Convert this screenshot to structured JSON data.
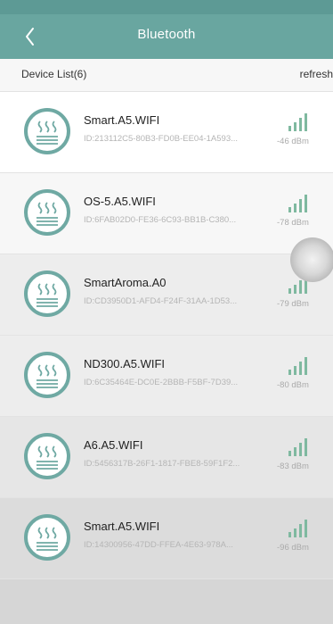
{
  "header": {
    "title": "Bluetooth"
  },
  "list_header": {
    "count_label": "Device List(6)",
    "refresh_label": "refresh"
  },
  "colors": {
    "accent": "#69a6a0",
    "signal": "#7fb9a0"
  },
  "devices": [
    {
      "name": "Smart.A5.WIFI",
      "id": "ID:213112C5-80B3-FD0B-EE04-1A593...",
      "rssi": "-46 dBm",
      "icon": "diffuser-icon",
      "signal_icon": "signal-bars-icon"
    },
    {
      "name": "OS-5.A5.WIFI",
      "id": "ID:6FAB02D0-FE36-6C93-BB1B-C380...",
      "rssi": "-78 dBm",
      "icon": "diffuser-icon",
      "signal_icon": "signal-bars-icon"
    },
    {
      "name": "SmartAroma.A0",
      "id": "ID:CD3950D1-AFD4-F24F-31AA-1D53...",
      "rssi": "-79 dBm",
      "icon": "diffuser-icon",
      "signal_icon": "signal-bars-icon"
    },
    {
      "name": "ND300.A5.WIFI",
      "id": "ID:6C35464E-DC0E-2BBB-F5BF-7D39...",
      "rssi": "-80 dBm",
      "icon": "diffuser-icon",
      "signal_icon": "signal-bars-icon"
    },
    {
      "name": "A6.A5.WIFI",
      "id": "ID:5456317B-26F1-1817-FBE8-59F1F2...",
      "rssi": "-83 dBm",
      "icon": "diffuser-icon",
      "signal_icon": "signal-bars-icon"
    },
    {
      "name": "Smart.A5.WIFI",
      "id": "ID:14300956-47DD-FFEA-4E63-978A...",
      "rssi": "-96 dBm",
      "icon": "diffuser-icon",
      "signal_icon": "signal-bars-icon"
    }
  ]
}
